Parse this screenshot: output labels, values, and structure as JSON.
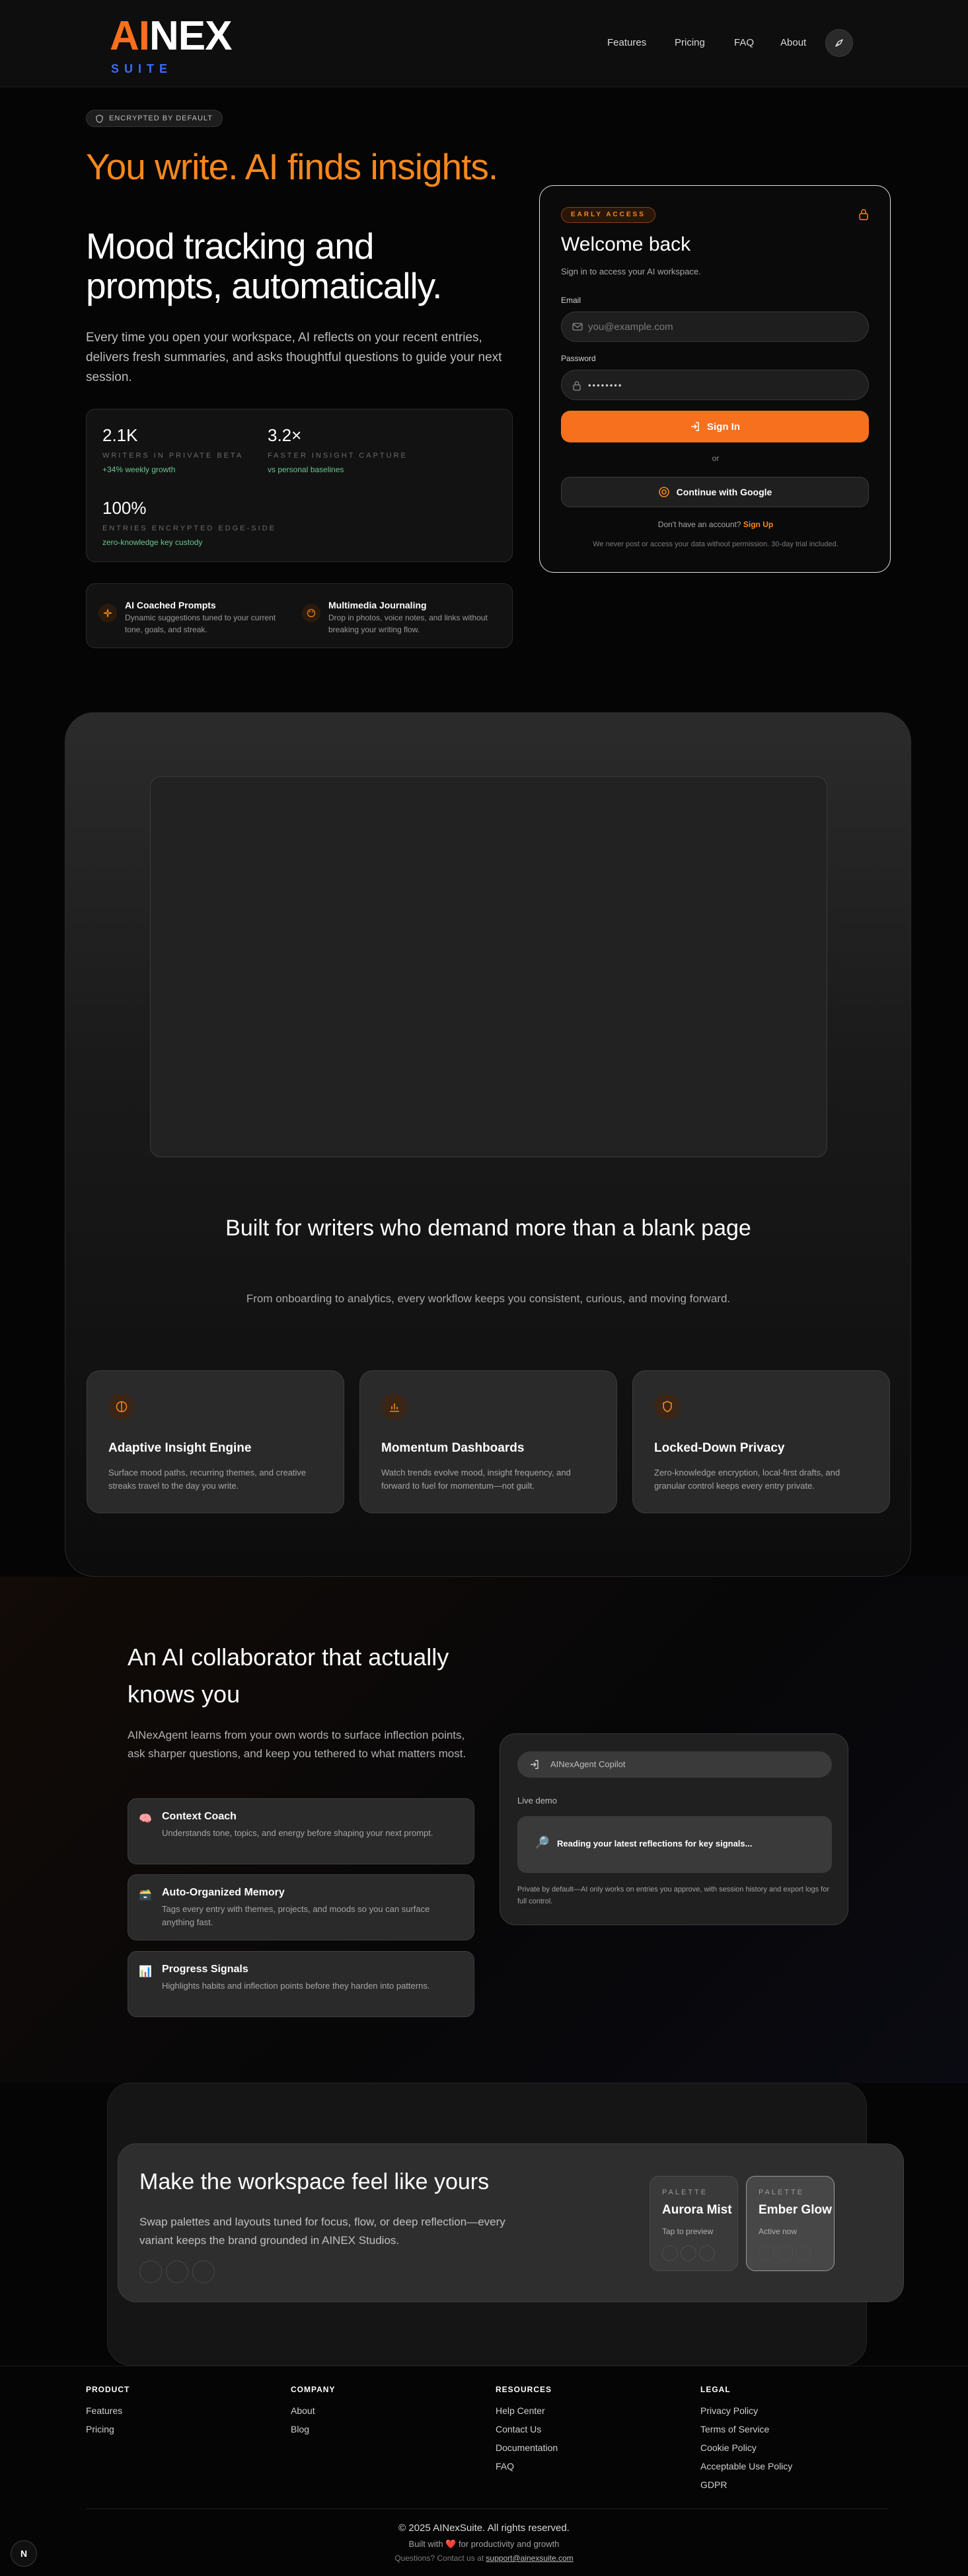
{
  "header": {
    "logo_ai": "AI",
    "logo_nex": "NEX",
    "logo_suite": "SUITE",
    "nav": [
      "Features",
      "Pricing",
      "FAQ",
      "About"
    ]
  },
  "hero": {
    "pill": "ENCRYPTED BY DEFAULT",
    "headline_orange": "You write. AI finds insights.",
    "headline_white": "Mood tracking and prompts, automatically.",
    "description": "Every time you open your workspace, AI reflects on your recent entries, delivers fresh summaries, and asks thoughtful questions to guide your next session.",
    "stats": [
      {
        "value": "2.1K",
        "label": "WRITERS IN PRIVATE BETA",
        "sub": "+34% weekly growth"
      },
      {
        "value": "3.2×",
        "label": "FASTER INSIGHT CAPTURE",
        "sub": "vs personal baselines"
      },
      {
        "value": "100%",
        "label": "ENTRIES ENCRYPTED EDGE-SIDE",
        "sub": "zero-knowledge key custody"
      }
    ],
    "mini_features": [
      {
        "title": "AI Coached Prompts",
        "desc": "Dynamic suggestions tuned to your current tone, goals, and streak."
      },
      {
        "title": "Multimedia Journaling",
        "desc": "Drop in photos, voice notes, and links without breaking your writing flow."
      }
    ]
  },
  "login": {
    "badge": "EARLY ACCESS",
    "title": "Welcome back",
    "subtitle": "Sign in to access your AI workspace.",
    "email_label": "Email",
    "email_placeholder": "you@example.com",
    "password_label": "Password",
    "password_value": "••••••••",
    "signin_label": "Sign In",
    "or": "or",
    "google_label": "Continue with Google",
    "signup_prompt": "Don't have an account?",
    "signup_link": "Sign Up",
    "disclaimer": "We never post or access your data without permission. 30-day trial included."
  },
  "features": {
    "heading": "Built for writers who demand more than a blank page",
    "description": "From onboarding to analytics, every workflow keeps you consistent, curious, and moving forward.",
    "cards": [
      {
        "icon": "brain-icon",
        "title": "Adaptive Insight Engine",
        "desc": "Surface mood paths, recurring themes, and creative streaks travel to the day you write."
      },
      {
        "icon": "bar-chart-icon",
        "title": "Momentum Dashboards",
        "desc": "Watch trends evolve mood, insight frequency, and forward to fuel for momentum—not guilt."
      },
      {
        "icon": "shield-icon",
        "title": "Locked-Down Privacy",
        "desc": "Zero-knowledge encryption, local-first drafts, and granular control keeps every entry private."
      }
    ]
  },
  "collab": {
    "heading": "An AI collaborator that actually knows you",
    "description": "AINexAgent learns from your own words to surface inflection points, ask sharper questions, and keep you tethered to what matters most.",
    "cards": [
      {
        "emoji": "🧠",
        "title": "Context Coach",
        "desc": "Understands tone, topics, and energy before shaping your next prompt."
      },
      {
        "emoji": "🗃️",
        "title": "Auto-Organized Memory",
        "desc": "Tags every entry with themes, projects, and moods so you can surface anything fast."
      },
      {
        "emoji": "📊",
        "title": "Progress Signals",
        "desc": "Highlights habits and inflection points before they harden into patterns."
      }
    ],
    "copilot_title": "AINexAgent Copilot",
    "live_demo": "Live demo",
    "demo_emoji": "🔎",
    "demo_text": "Reading your latest reflections for key signals...",
    "note": "Private by default—AI only works on entries you approve, with session history and export logs for full control."
  },
  "palette": {
    "heading": "Make the workspace feel like yours",
    "description": "Swap palettes and layouts tuned for focus, flow, or deep reflection—every variant keeps the brand grounded in AINEX Studios.",
    "cards": [
      {
        "kicker": "PALETTE",
        "name": "Aurora Mist",
        "status": "Tap to preview"
      },
      {
        "kicker": "PALETTE",
        "name": "Ember Glow",
        "status": "Active now"
      }
    ]
  },
  "footer": {
    "columns": [
      {
        "heading": "PRODUCT",
        "links": [
          "Features",
          "Pricing"
        ]
      },
      {
        "heading": "COMPANY",
        "links": [
          "About",
          "Blog"
        ]
      },
      {
        "heading": "RESOURCES",
        "links": [
          "Help Center",
          "Contact Us",
          "Documentation",
          "FAQ"
        ]
      },
      {
        "heading": "LEGAL",
        "links": [
          "Privacy Policy",
          "Terms of Service",
          "Cookie Policy",
          "Acceptable Use Policy",
          "GDPR"
        ]
      }
    ],
    "copyright": "© 2025 AINexSuite. All rights reserved.",
    "built_pre": "Built with",
    "built_heart": "❤️",
    "built_post": "for productivity and growth",
    "contact_pre": "Questions? Contact us at",
    "contact_email": "support@ainexsuite.com",
    "badge": "N"
  },
  "colors": {
    "accent": "#f7701d",
    "suite_blue": "#3b6cf6",
    "growth_green": "#6cc690"
  }
}
